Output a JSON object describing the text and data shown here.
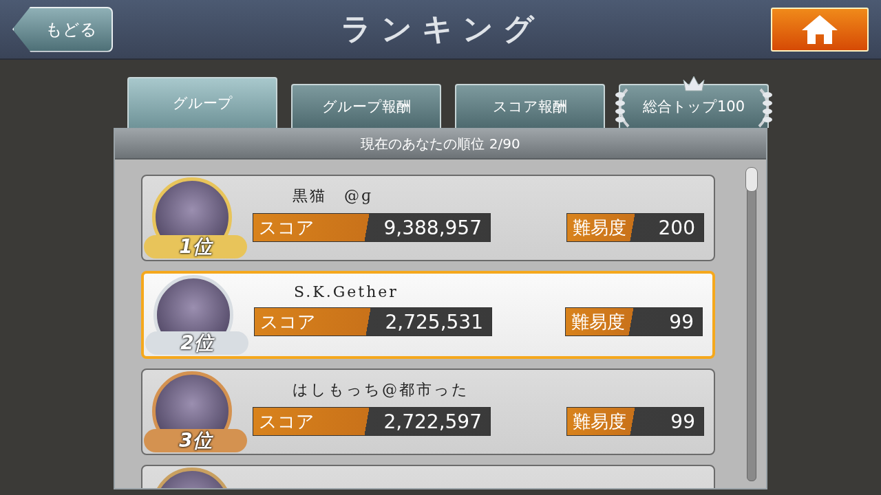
{
  "header": {
    "back_button": "もどる",
    "title": "ランキング"
  },
  "tabs": [
    {
      "label": "グループ",
      "selected": true,
      "kind": "plain"
    },
    {
      "label": "グループ報酬",
      "selected": false,
      "kind": "plain"
    },
    {
      "label": "スコア報酬",
      "selected": false,
      "kind": "plain"
    },
    {
      "label": "総合トップ100",
      "selected": false,
      "kind": "crown"
    }
  ],
  "rank_line": "現在のあなたの順位 2/90",
  "rows": [
    {
      "kind": "full",
      "color": "#e8c45a",
      "rank": "1位",
      "name": "黒猫　@ɡ",
      "score_label": "スコア",
      "score": "9,388,957",
      "difficulty_label": "難易度",
      "difficulty": "200",
      "selected": false
    },
    {
      "kind": "full",
      "color": "#d8dde2",
      "rank": "2位",
      "name": "S.K.Gether",
      "score_label": "スコア",
      "score": "2,725,531",
      "difficulty_label": "難易度",
      "difficulty": "99",
      "selected": true
    },
    {
      "kind": "full",
      "color": "#d49250",
      "rank": "3位",
      "name": "はしもっち@都市った",
      "score_label": "スコア",
      "score": "2,722,597",
      "difficulty_label": "難易度",
      "difficulty": "99",
      "selected": false
    },
    {
      "kind": "partial",
      "color": "#c9a060",
      "selected": false
    }
  ]
}
